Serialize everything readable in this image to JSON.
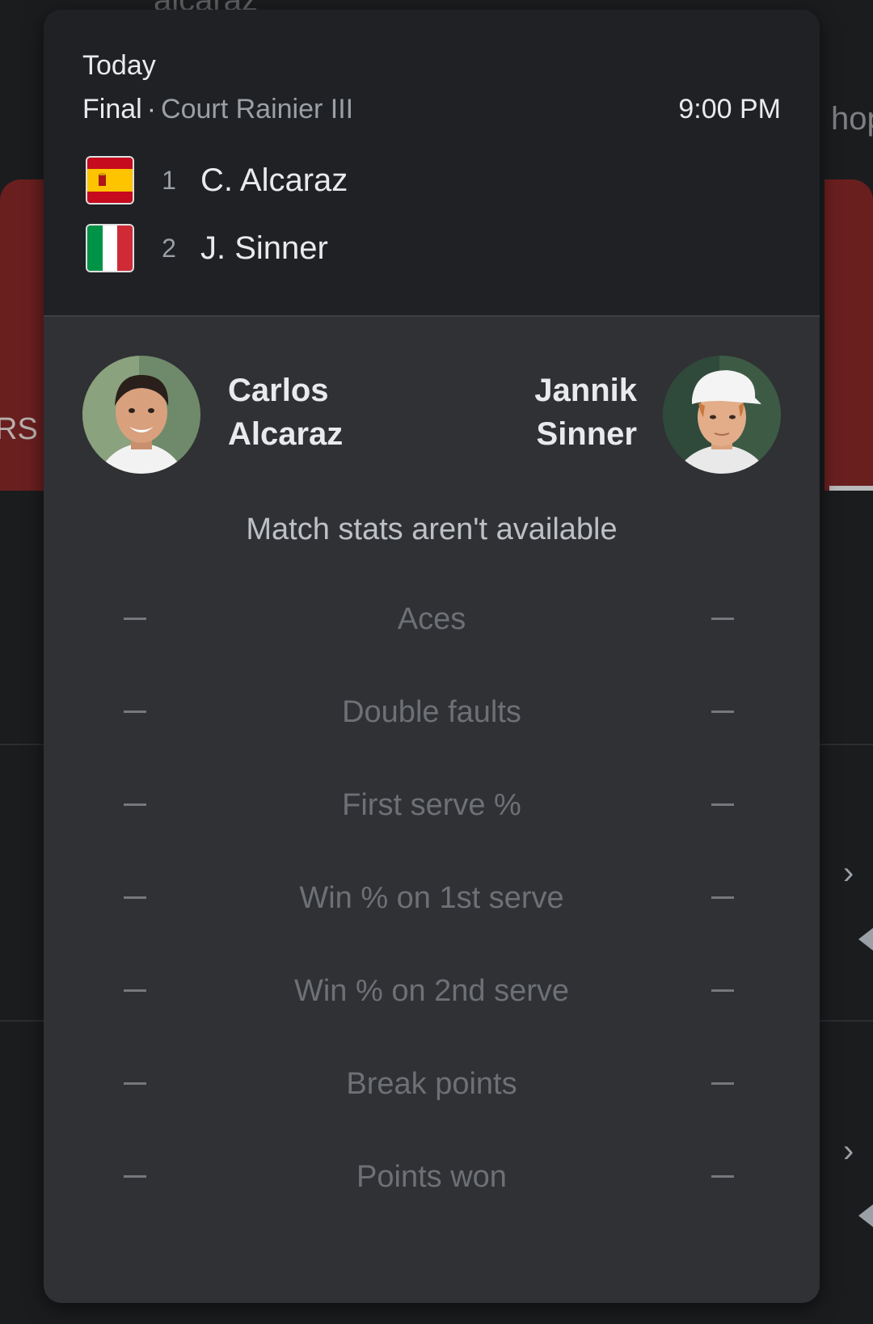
{
  "background": {
    "search_query": "alcaraz",
    "left_fragment": "RS",
    "right_fragment": "hop",
    "chevron": "›"
  },
  "match": {
    "date": "Today",
    "status": "Final",
    "separator": "·",
    "court": "Court Rainier III",
    "time": "9:00 PM",
    "players": [
      {
        "seed": "1",
        "short_name": "C. Alcaraz",
        "flag": "spain-flag-icon"
      },
      {
        "seed": "2",
        "short_name": "J. Sinner",
        "flag": "italy-flag-icon"
      }
    ]
  },
  "head_to_head": {
    "left": {
      "first_name": "Carlos",
      "last_name": "Alcaraz"
    },
    "right": {
      "first_name": "Jannik",
      "last_name": "Sinner"
    }
  },
  "stats": {
    "unavailable_message": "Match stats aren't available",
    "rows": [
      {
        "label": "Aces",
        "left": "—",
        "right": "—"
      },
      {
        "label": "Double faults",
        "left": "—",
        "right": "—"
      },
      {
        "label": "First serve %",
        "left": "—",
        "right": "—"
      },
      {
        "label": "Win % on 1st serve",
        "left": "—",
        "right": "—"
      },
      {
        "label": "Win % on 2nd serve",
        "left": "—",
        "right": "—"
      },
      {
        "label": "Break points",
        "left": "—",
        "right": "—"
      },
      {
        "label": "Points won",
        "left": "—",
        "right": "—"
      }
    ]
  },
  "colors": {
    "card_header": "#202124",
    "card_body": "#303134",
    "spain_red": "#c60b1e",
    "spain_yellow": "#ffc400",
    "italy_green": "#009246",
    "italy_white": "#ffffff",
    "italy_red": "#ce2b37"
  }
}
